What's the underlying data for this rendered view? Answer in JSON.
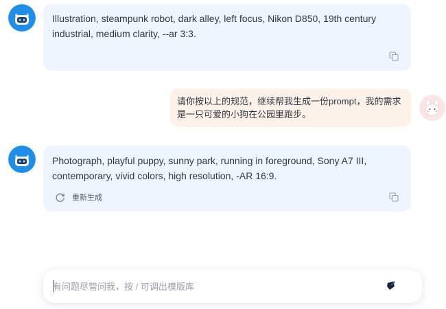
{
  "messages": [
    {
      "role": "bot",
      "lines": [
        "Illustration, steampunk robot, dark alley, left focus, Nikon D850, 19th century",
        "industrial, medium clarity, --ar 3:3."
      ],
      "copy_icon": "copy-icon"
    },
    {
      "role": "user",
      "lines": [
        "请你按以上的规范，继续帮我生成一份prompt，我的需求",
        "是一只可爱的小狗在公园里跑步。"
      ]
    },
    {
      "role": "bot",
      "lines": [
        "Photograph, playful puppy, sunny park, running in foreground, Sony A7 III,",
        "contemporary, vivid colors, high resolution, -AR 16:9."
      ],
      "regenerate_label": "重新生成",
      "regenerate_icon": "refresh-icon",
      "copy_icon": "copy-icon"
    }
  ],
  "input": {
    "placeholder": "有问题尽管问我，按 / 可调出模版库",
    "value": "",
    "send_icon": "send-icon"
  },
  "colors": {
    "bot_bubble": "#eef5fe",
    "user_bubble": "#fcf2e9",
    "bot_avatar": "#1f8ee8",
    "user_avatar_bg": "#fbe6e6"
  }
}
